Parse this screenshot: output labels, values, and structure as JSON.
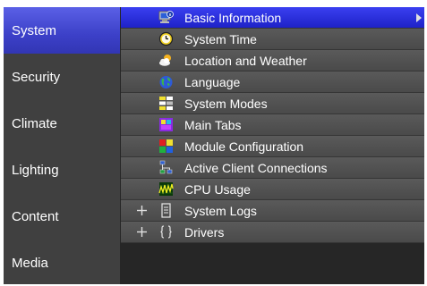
{
  "sidebar": {
    "items": [
      {
        "label": "System",
        "active": true
      },
      {
        "label": "Security",
        "active": false
      },
      {
        "label": "Climate",
        "active": false
      },
      {
        "label": "Lighting",
        "active": false
      },
      {
        "label": "Content",
        "active": false
      },
      {
        "label": "Media",
        "active": false
      }
    ]
  },
  "tree": {
    "items": [
      {
        "label": "Basic Information",
        "icon": "computer-info-icon",
        "selected": true
      },
      {
        "label": "System Time",
        "icon": "clock-icon"
      },
      {
        "label": "Location and Weather",
        "icon": "weather-cloud-icon"
      },
      {
        "label": "Language",
        "icon": "globe-icon"
      },
      {
        "label": "System Modes",
        "icon": "modes-icon"
      },
      {
        "label": "Main Tabs",
        "icon": "tabs-icon"
      },
      {
        "label": "Module Configuration",
        "icon": "module-grid-icon"
      },
      {
        "label": "Active Client Connections",
        "icon": "network-clients-icon"
      },
      {
        "label": "CPU Usage",
        "icon": "cpu-graph-icon"
      },
      {
        "label": "System Logs",
        "icon": "log-document-icon",
        "expandable": true
      },
      {
        "label": "Drivers",
        "icon": "braces-icon",
        "expandable": true
      }
    ]
  },
  "colors": {
    "sidebar_bg": "#404040",
    "sidebar_active": "#4a4fd8",
    "row_bg": "#505050",
    "row_selected": "#2b30e0",
    "content_bg": "#262626"
  }
}
